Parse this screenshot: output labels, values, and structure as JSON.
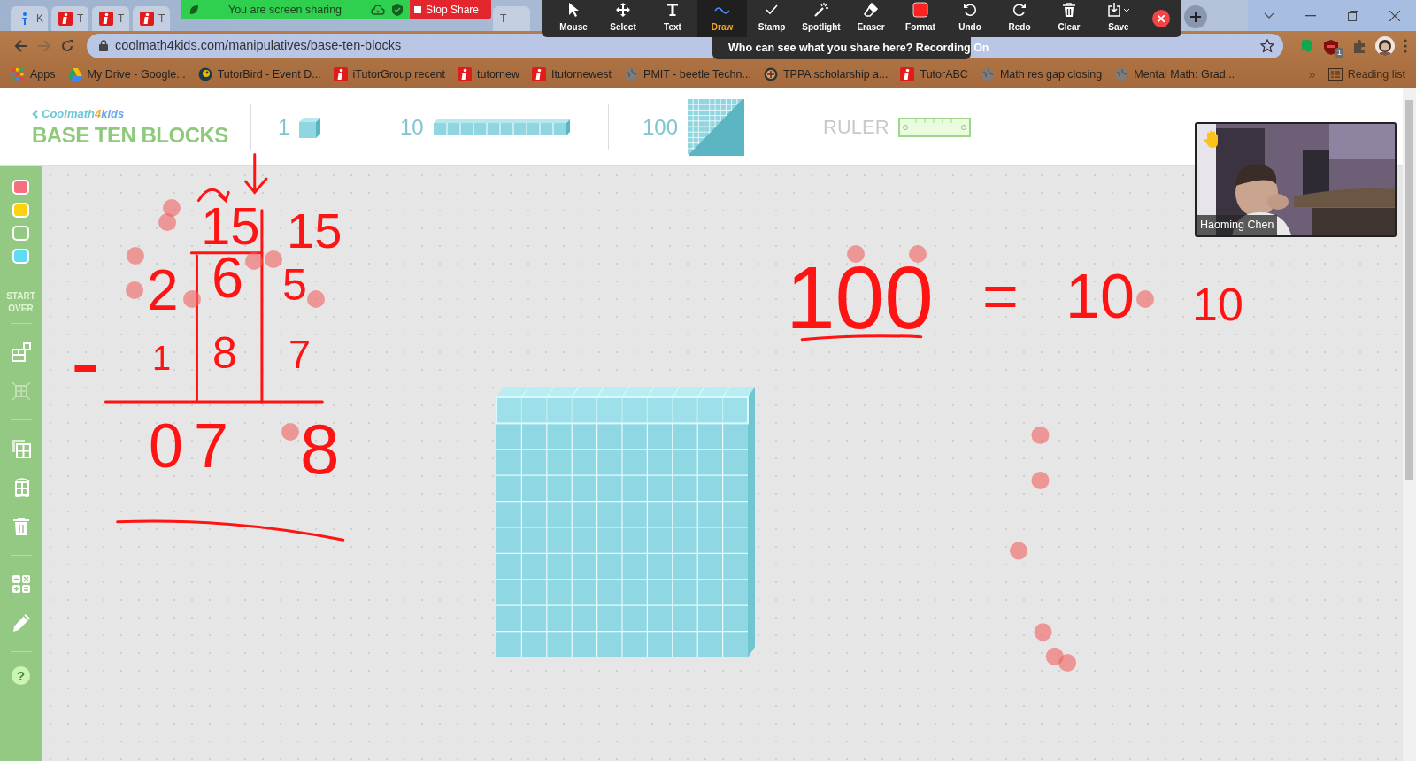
{
  "browser": {
    "tabs": [
      {
        "label": "K",
        "kind": "person"
      },
      {
        "label": "T",
        "kind": "info"
      },
      {
        "label": "T",
        "kind": "info"
      },
      {
        "label": "T",
        "kind": "info"
      },
      {
        "label": "T",
        "kind": "plain"
      }
    ],
    "url": "coolmath4kids.com/manipulatives/base-ten-blocks",
    "extension_badge": "1",
    "bookmarks": [
      {
        "label": "Apps",
        "kind": "grid"
      },
      {
        "label": "My Drive - Google...",
        "kind": "triangle"
      },
      {
        "label": "TutorBird - Event D...",
        "kind": "bird"
      },
      {
        "label": "iTutorGroup recent",
        "kind": "info"
      },
      {
        "label": "tutornew",
        "kind": "info"
      },
      {
        "label": "Itutornewest",
        "kind": "info"
      },
      {
        "label": "PMIT - beetle Techn...",
        "kind": "globe"
      },
      {
        "label": "TPPA scholarship a...",
        "kind": "crest"
      },
      {
        "label": "TutorABC",
        "kind": "info"
      },
      {
        "label": "Math res gap closing",
        "kind": "globe"
      },
      {
        "label": "Mental Math: Grad...",
        "kind": "globe"
      }
    ],
    "more": "»",
    "reading_list": "Reading list"
  },
  "sharing_banner": {
    "status": "You are screen sharing",
    "stop_button": "Stop Share"
  },
  "annotation_toolbar": {
    "tools": [
      {
        "label": "Mouse",
        "selected": false
      },
      {
        "label": "Select",
        "selected": false
      },
      {
        "label": "Text",
        "selected": false
      },
      {
        "label": "Draw",
        "selected": true
      },
      {
        "label": "Stamp",
        "selected": false
      },
      {
        "label": "Spotlight",
        "selected": false
      },
      {
        "label": "Eraser",
        "selected": false
      },
      {
        "label": "Format",
        "selected": false
      },
      {
        "label": "Undo",
        "selected": false
      },
      {
        "label": "Redo",
        "selected": false
      },
      {
        "label": "Clear",
        "selected": false
      },
      {
        "label": "Save",
        "selected": false
      }
    ],
    "notice": "Who can see what you share here? Recording On"
  },
  "app": {
    "logo": [
      "Coolmath",
      "4",
      "kids"
    ],
    "title": "BASE TEN BLOCKS",
    "palette": [
      {
        "kind": "unit",
        "label": "1"
      },
      {
        "kind": "rod",
        "label": "10"
      },
      {
        "kind": "flat",
        "label": "100"
      },
      {
        "kind": "ruler",
        "label": "RULER"
      }
    ],
    "sidebar": {
      "colors": [
        {
          "color": "#f5707c"
        },
        {
          "color": "#fdd10f"
        },
        {
          "color": "#93c983"
        },
        {
          "color": "#5fdcf2"
        }
      ],
      "start_over": "START OVER",
      "help": "?"
    },
    "canvas": {
      "annotations": [
        {
          "text": "15"
        },
        {
          "text": "15"
        },
        {
          "text": "2"
        },
        {
          "text": "6"
        },
        {
          "text": "5"
        },
        {
          "text": "-"
        },
        {
          "text": "1"
        },
        {
          "text": "8"
        },
        {
          "text": "7"
        },
        {
          "text": "0"
        },
        {
          "text": "7"
        },
        {
          "text": "8"
        },
        {
          "text": "100"
        },
        {
          "text": "="
        },
        {
          "text": "10"
        },
        {
          "text": "10"
        }
      ]
    }
  },
  "video": {
    "name": "Haoming Chen",
    "hand_raised": true
  }
}
